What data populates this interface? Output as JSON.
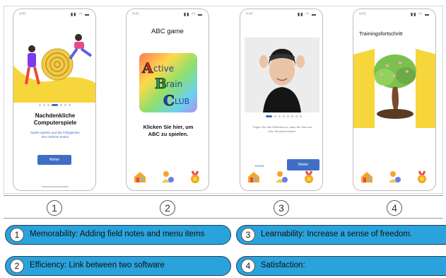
{
  "screens": [
    {
      "status_time": "9:41",
      "title": "Nachdenkliche Computerspiele",
      "description": "Spiele spielen und die Fähigkeiten des Gehirns testen",
      "button_label": "Weiter",
      "number": "1"
    },
    {
      "status_time": "9:41",
      "title": "ABC game",
      "logo_text": "Active Brain CLUB",
      "prompt": "Klicken Sie hier, um ABC zu spielen.",
      "number": "2"
    },
    {
      "status_time": "9:41",
      "caption": "Tragen Sie das Stirnband so, dass die Haut auf Ihrer Stirnhaut bleiben",
      "back_label": "zurück",
      "button_label": "Weiter",
      "number": "3"
    },
    {
      "status_time": "9:41",
      "title": "Trainingsfortschritt",
      "number": "4"
    }
  ],
  "notes": [
    {
      "number": "1",
      "text": "Memorability: Adding field notes and menu items"
    },
    {
      "number": "2",
      "text": "Efficiency: Link between two software"
    },
    {
      "number": "3",
      "text": "Learnability: Increase a sense of freedom."
    },
    {
      "number": "4",
      "text": "Satisfaction:"
    }
  ],
  "colors": {
    "accent_blue": "#3f6fc4",
    "pill_fill": "#2aa3dc",
    "pill_border": "#1f3f62",
    "yellow": "#f6d63a"
  },
  "icons": [
    "home-icon",
    "user-brain-icon",
    "medal-icon"
  ]
}
